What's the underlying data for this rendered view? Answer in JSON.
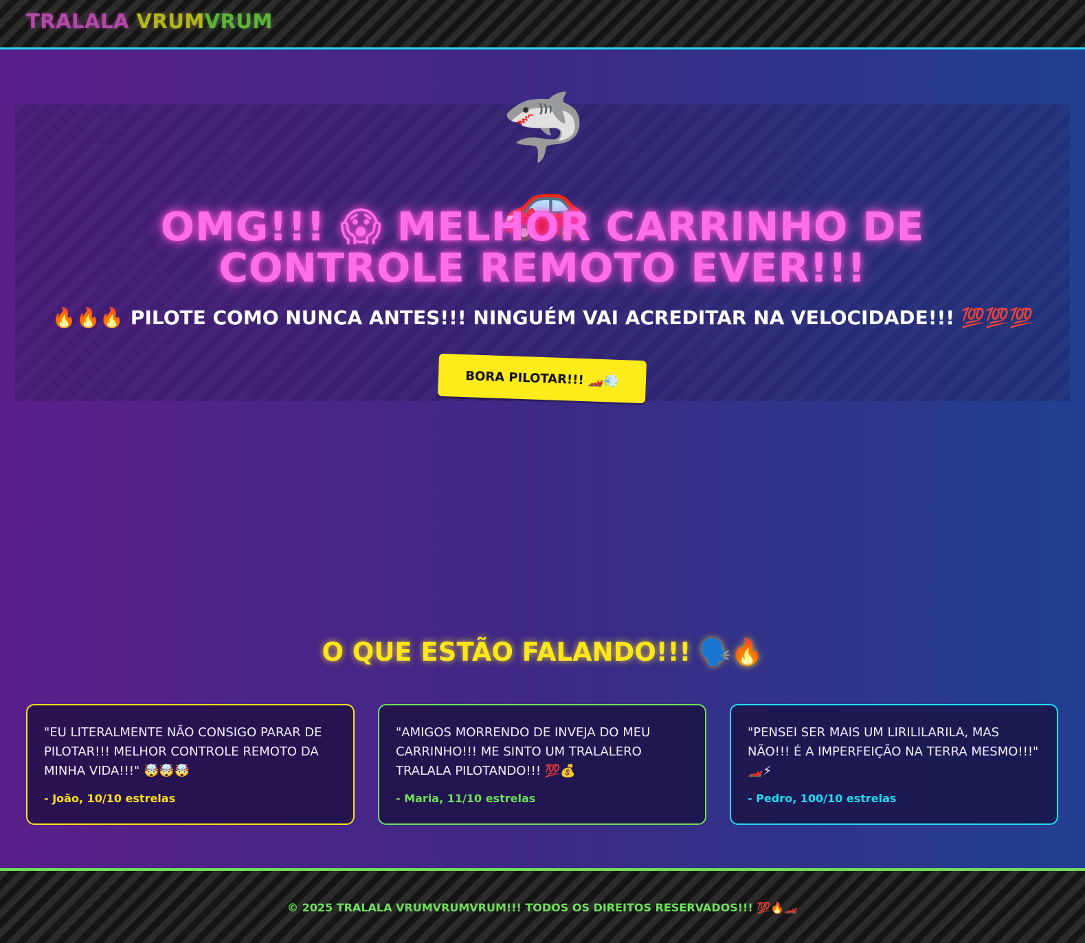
{
  "header": {
    "logo_part1": "TRALALA",
    "logo_part2": "VRUM",
    "logo_part3": "VRUM"
  },
  "hero": {
    "emoji": "🦈🚗",
    "title": "OMG!!! 😱 MELHOR CARRINHO DE CONTROLE REMOTO EVER!!!",
    "subtitle": "🔥🔥🔥 PILOTE COMO NUNCA ANTES!!! NINGUÉM VAI ACREDITAR NA VELOCIDADE!!! 💯💯💯",
    "cta_label": "BORA PILOTAR!!! 🏎️💨"
  },
  "testimonials": {
    "title": "O QUE ESTÃO FALANDO!!! 🗣️🔥",
    "items": [
      {
        "quote": "\"EU LITERALMENTE NÃO CONSIGO PARAR DE PILOTAR!!! MELHOR CONTROLE REMOTO DA MINHA VIDA!!!\" 🤯🤯🤯",
        "author": "- João, 10/10 estrelas"
      },
      {
        "quote": "\"AMIGOS MORRENDO DE INVEJA DO MEU CARRINHO!!! ME SINTO UM TRALALERO TRALALA PILOTANDO!!! 💯💰",
        "author": "- Maria, 11/10 estrelas"
      },
      {
        "quote": "\"PENSEI SER MAIS UM LIRILILARILA, MAS NÃO!!! É A IMPERFEIÇÃO NA TERRA MESMO!!!\" 🏎️⚡",
        "author": "- Pedro, 100/10 estrelas"
      }
    ]
  },
  "footer": {
    "text": "© 2025 TRALALA VRUMVRUMVRUM!!! TODOS OS DIREITOS RESERVADOS!!! 💯🔥🏎️"
  },
  "colors": {
    "accent_pink": "#ff6ee8",
    "accent_yellow": "#ffe61a",
    "accent_green": "#6ee05a",
    "accent_cyan": "#23dcf2"
  }
}
